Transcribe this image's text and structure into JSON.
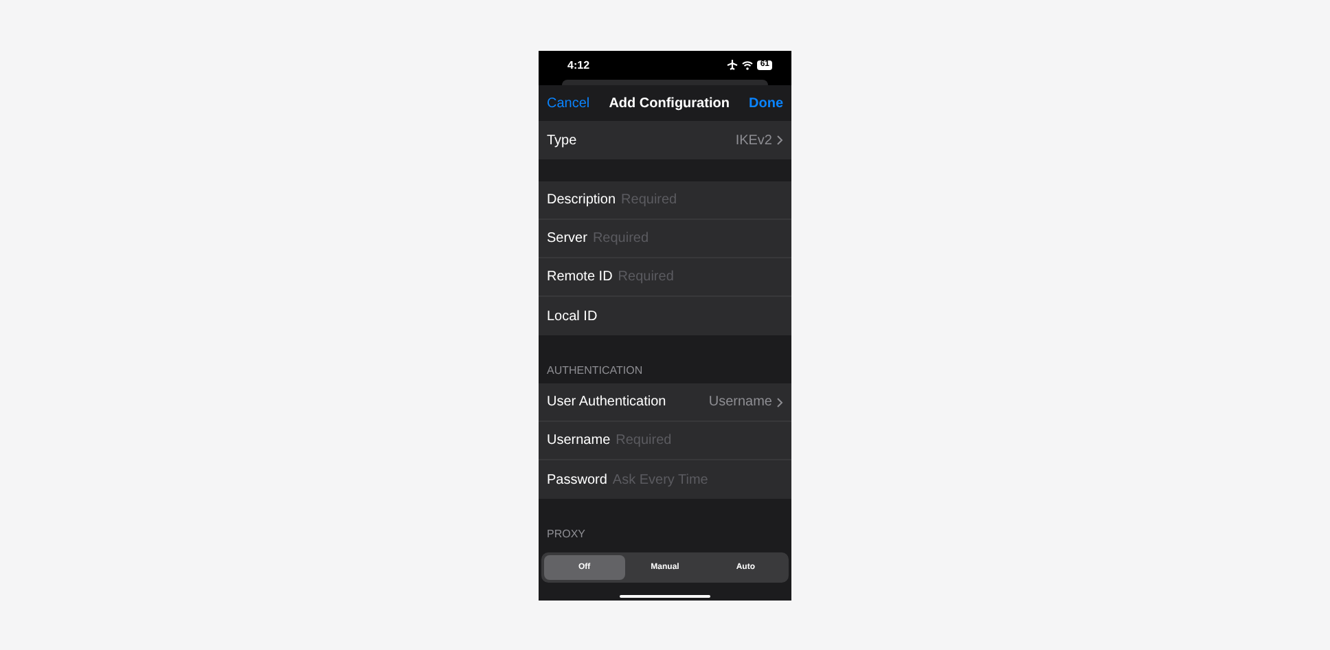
{
  "status_bar": {
    "time": "4:12",
    "battery": "61"
  },
  "nav": {
    "cancel": "Cancel",
    "title": "Add Configuration",
    "done": "Done"
  },
  "sections": [
    {
      "rows": [
        {
          "kind": "value",
          "label": "Type",
          "value": "IKEv2"
        }
      ]
    },
    {
      "rows": [
        {
          "kind": "field",
          "label": "Description",
          "placeholder": "Required"
        },
        {
          "kind": "field",
          "label": "Server",
          "placeholder": "Required"
        },
        {
          "kind": "field",
          "label": "Remote ID",
          "placeholder": "Required"
        },
        {
          "kind": "field",
          "label": "Local ID"
        }
      ]
    },
    {
      "header": "AUTHENTICATION",
      "rows": [
        {
          "kind": "value",
          "label": "User Authentication",
          "value": "Username"
        },
        {
          "kind": "field",
          "label": "Username",
          "placeholder": "Required"
        },
        {
          "kind": "field",
          "label": "Password",
          "placeholder": "Ask Every Time"
        }
      ]
    },
    {
      "header": "PROXY"
    }
  ],
  "proxy_segments": [
    {
      "label": "Off",
      "selected": true
    },
    {
      "label": "Manual",
      "selected": false
    },
    {
      "label": "Auto",
      "selected": false
    }
  ]
}
